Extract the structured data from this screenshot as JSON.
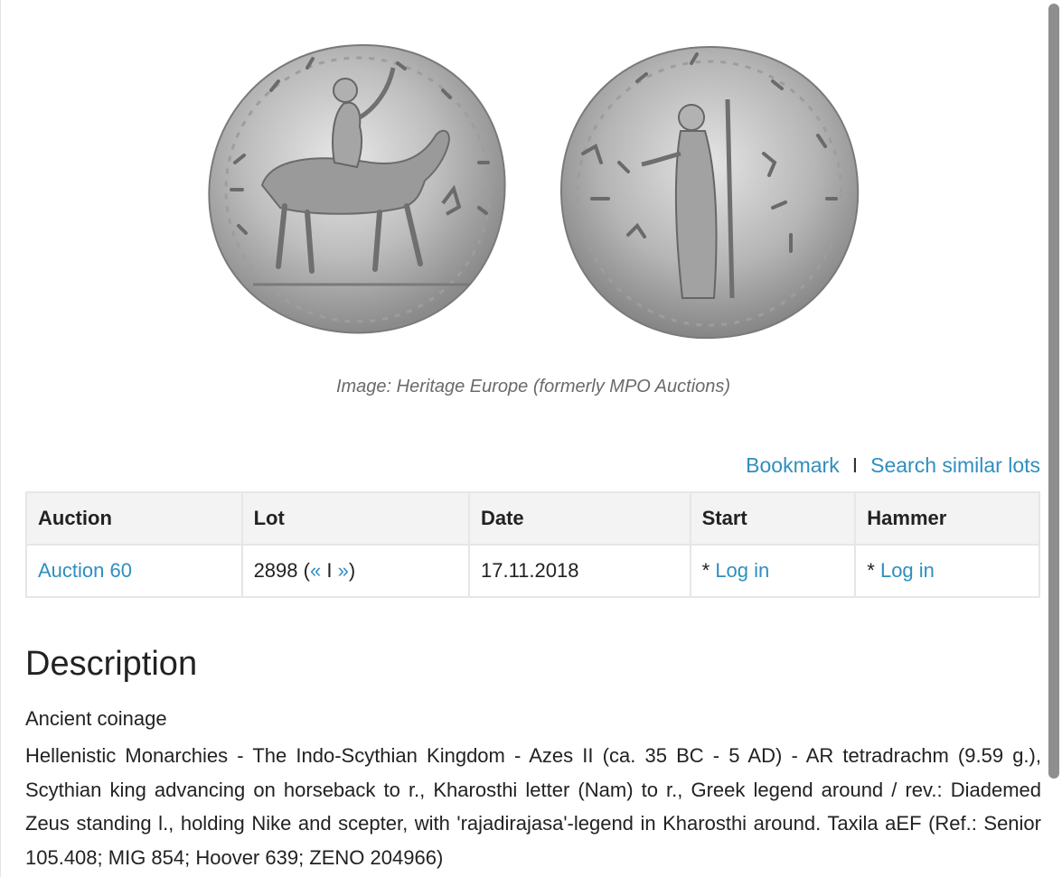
{
  "image": {
    "caption": "Image: Heritage Europe (formerly MPO Auctions)"
  },
  "actions": {
    "bookmark": "Bookmark",
    "separator": "I",
    "search_similar": "Search similar lots"
  },
  "table": {
    "headers": [
      "Auction",
      "Lot",
      "Date",
      "Start",
      "Hammer"
    ],
    "row": {
      "auction": "Auction 60",
      "lot_number": "2898",
      "lot_open": " (",
      "prev": "«",
      "lot_sep": " I ",
      "next": "»",
      "lot_close": ")",
      "date": "17.11.2018",
      "start_prefix": "* ",
      "start_link": "Log in",
      "hammer_prefix": "* ",
      "hammer_link": "Log in"
    }
  },
  "description": {
    "title": "Description",
    "category": "Ancient coinage",
    "text": "Hellenistic Monarchies - The Indo-Scythian Kingdom - Azes II (ca. 35 BC - 5 AD) - AR tetradrachm (9.59 g.), Scythian king advancing on horseback to r., Kharosthi letter (Nam) to r., Greek legend around / rev.: Diademed Zeus standing l., holding Nike and scepter, with 'rajadirajasa'-legend in Kharosthi around. Taxila aEF (Ref.: Senior 105.408; MIG 854; Hoover 639; ZENO 204966)"
  },
  "colors": {
    "link": "#2f8ebf",
    "header_bg": "#f3f3f3",
    "border": "#e6e6e6",
    "caption": "#6a6a6a"
  }
}
